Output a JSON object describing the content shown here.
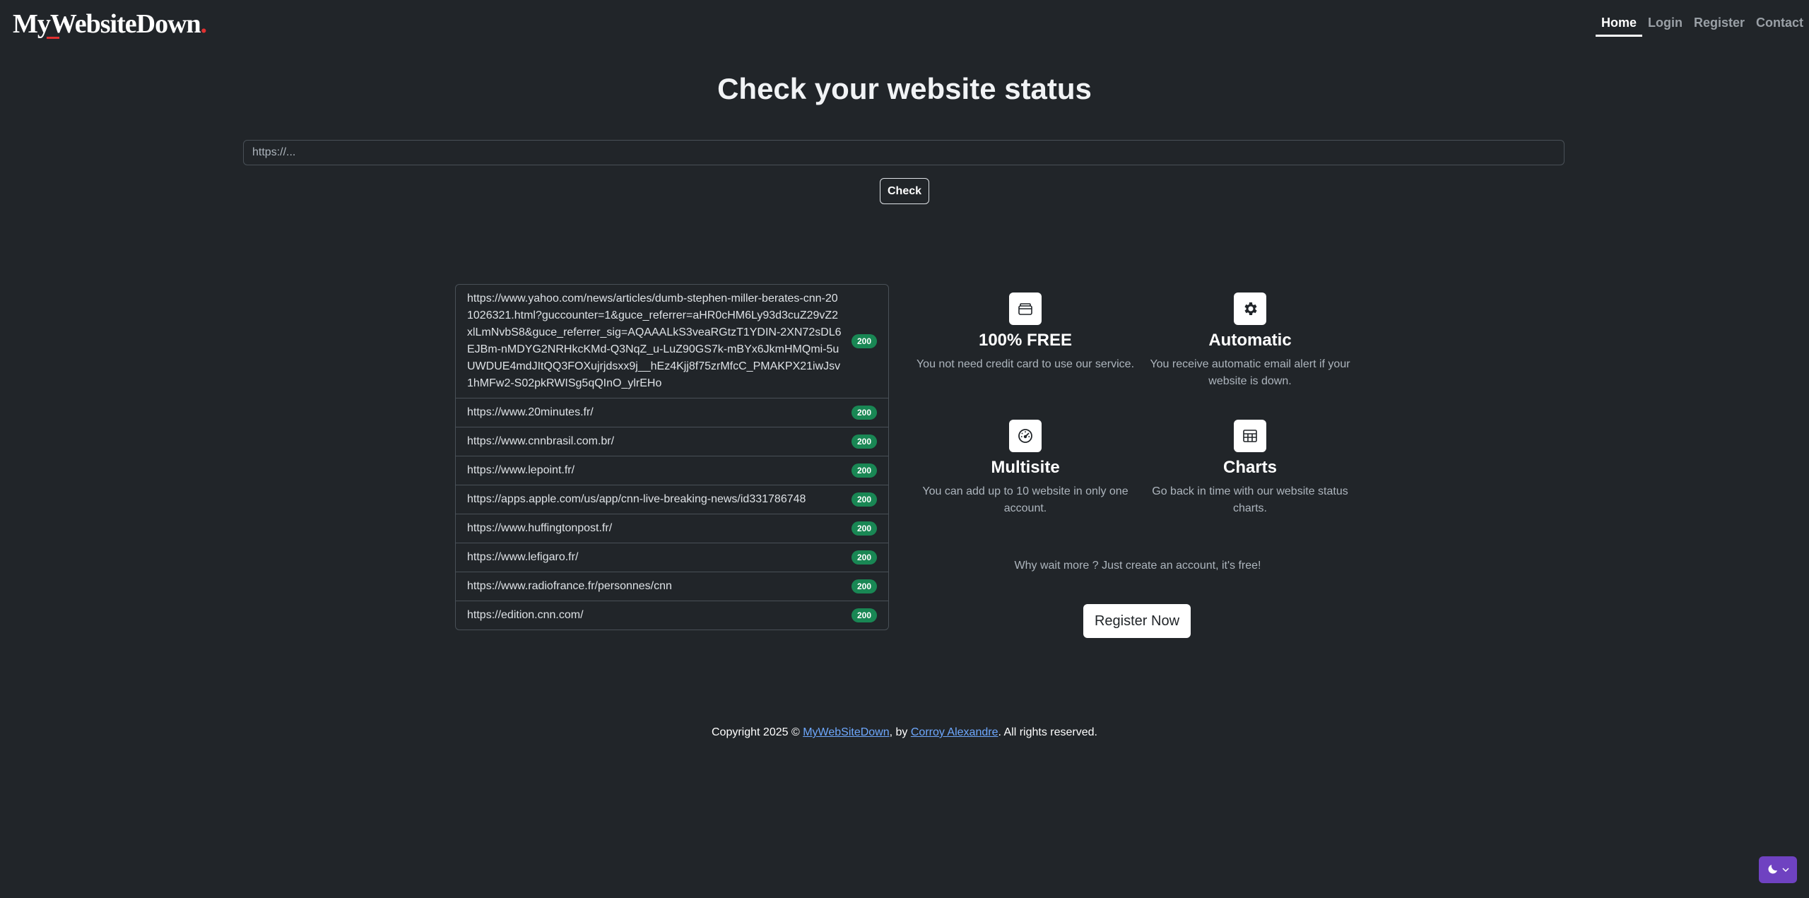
{
  "header": {
    "logo_text": "MyWebsiteDown",
    "logo_dot": ".",
    "nav": [
      {
        "label": "Home",
        "active": true
      },
      {
        "label": "Login",
        "active": false
      },
      {
        "label": "Register",
        "active": false
      },
      {
        "label": "Contact",
        "active": false
      }
    ]
  },
  "main": {
    "title": "Check your website status",
    "url_input": {
      "placeholder": "https://...",
      "value": ""
    },
    "check_label": "Check"
  },
  "sites": [
    {
      "url": "https://www.yahoo.com/news/articles/dumb-stephen-miller-berates-cnn-201026321.html?guccounter=1&guce_referrer=aHR0cHM6Ly93d3cuZ29vZ2xlLmNvbS8&guce_referrer_sig=AQAAALkS3veaRGtzT1YDIN-2XN72sDL6EJBm-nMDYG2NRHkcKMd-Q3NqZ_u-LuZ90GS7k-mBYx6JkmHMQmi-5uUWDUE4mdJItQQ3FOXujrjdsxx9j__hEz4Kjj8f75zrMfcC_PMAKPX21iwJsv1hMFw2-S02pkRWISg5qQInO_ylrEHo",
      "status": "200"
    },
    {
      "url": "https://www.20minutes.fr/",
      "status": "200"
    },
    {
      "url": "https://www.cnnbrasil.com.br/",
      "status": "200"
    },
    {
      "url": "https://www.lepoint.fr/",
      "status": "200"
    },
    {
      "url": "https://apps.apple.com/us/app/cnn-live-breaking-news/id331786748",
      "status": "200"
    },
    {
      "url": "https://www.huffingtonpost.fr/",
      "status": "200"
    },
    {
      "url": "https://www.lefigaro.fr/",
      "status": "200"
    },
    {
      "url": "https://www.radiofrance.fr/personnes/cnn",
      "status": "200"
    },
    {
      "url": "https://edition.cnn.com/",
      "status": "200"
    }
  ],
  "features": [
    {
      "icon": "wallet-icon",
      "title": "100% FREE",
      "desc": "You not need credit card to use our service."
    },
    {
      "icon": "gear-icon",
      "title": "Automatic",
      "desc": "You receive automatic email alert if your website is down."
    },
    {
      "icon": "speedometer-icon",
      "title": "Multisite",
      "desc": "You can add up to 10 website in only one account."
    },
    {
      "icon": "table-icon",
      "title": "Charts",
      "desc": "Go back in time with our website status charts."
    }
  ],
  "cta": {
    "text": "Why wait more ? Just create an account, it's free!",
    "register_label": "Register Now"
  },
  "footer": {
    "prefix": "Copyright 2025 © ",
    "site_link": "MyWebSiteDown",
    "middle": ", by ",
    "author_link": "Corroy Alexandre",
    "suffix": ". All rights reserved."
  },
  "theme_toggle": {
    "icon": "moon-icon"
  },
  "colors": {
    "background": "#212529",
    "status_ok": "#198754",
    "link": "#6ea8fe",
    "theme_button": "#6f42c1",
    "logo_accent": "#e03131"
  }
}
